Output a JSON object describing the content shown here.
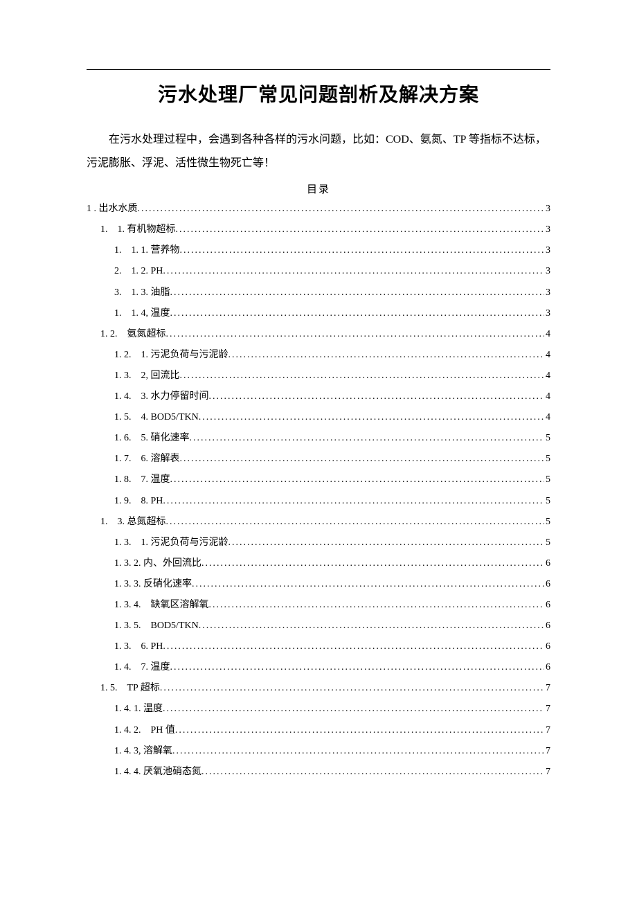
{
  "title": "污水处理厂常见问题剖析及解决方案",
  "intro": "在污水处理过程中，会遇到各种各样的污水问题，比如：COD、氨氮、TP 等指标不达标，污泥膨胀、浮泥、活性微生物死亡等！",
  "toc_header": "目录",
  "toc": [
    {
      "indent": 0,
      "label": "1 . 出水水质",
      "page": "3"
    },
    {
      "indent": 1,
      "label": "1.　1. 有机物超标",
      "page": "3"
    },
    {
      "indent": 2,
      "label": "1.　1. 1. 营养物",
      "page": "3"
    },
    {
      "indent": 2,
      "label": "2.　1. 2. PH",
      "page": "3"
    },
    {
      "indent": 2,
      "label": "3.　1. 3. 油脂",
      "page": "3"
    },
    {
      "indent": 2,
      "label": "1.　1. 4, 温度",
      "page": "3"
    },
    {
      "indent": 1,
      "label": "1. 2.　氨氮超标",
      "page": "4"
    },
    {
      "indent": 2,
      "label": "1. 2.　1. 污泥负荷与污泥龄",
      "page": "4"
    },
    {
      "indent": 2,
      "label": "1. 3.　2, 回流比",
      "page": "4"
    },
    {
      "indent": 2,
      "label": "1. 4.　3. 水力停留时间",
      "page": "4"
    },
    {
      "indent": 2,
      "label": "1. 5.　4. BOD5/TKN",
      "page": "4"
    },
    {
      "indent": 2,
      "label": "1. 6.　5. 硝化速率",
      "page": "5"
    },
    {
      "indent": 2,
      "label": "1. 7.　6. 溶解表",
      "page": "5"
    },
    {
      "indent": 2,
      "label": "1. 8.　7. 温度",
      "page": "5"
    },
    {
      "indent": 2,
      "label": "1. 9.　8. PH",
      "page": "5"
    },
    {
      "indent": 1,
      "label": "1.　3. 总氮超标",
      "page": "5"
    },
    {
      "indent": 2,
      "label": "1. 3.　1. 污泥负荷与污泥龄",
      "page": "5"
    },
    {
      "indent": 2,
      "label": "1. 3. 2. 内、外回流比",
      "page": "6"
    },
    {
      "indent": 2,
      "label": "1. 3. 3. 反硝化速率",
      "page": "6"
    },
    {
      "indent": 2,
      "label": "1. 3. 4.　缺氧区溶解氧",
      "page": "6"
    },
    {
      "indent": 2,
      "label": "1. 3. 5.　BOD5/TKN",
      "page": "6"
    },
    {
      "indent": 2,
      "label": "1. 3.　6. PH",
      "page": "6"
    },
    {
      "indent": 2,
      "label": "1. 4.　7. 温度",
      "page": "6"
    },
    {
      "indent": 1,
      "label": "1. 5.　TP 超标",
      "page": "7"
    },
    {
      "indent": 2,
      "label": "1. 4. 1. 温度",
      "page": "7"
    },
    {
      "indent": 2,
      "label": "1. 4. 2.　PH 值",
      "page": "7"
    },
    {
      "indent": 2,
      "label": "1. 4. 3, 溶解氧",
      "page": "7"
    },
    {
      "indent": 2,
      "label": "1. 4. 4. 厌氧池硝态氮",
      "page": "7"
    }
  ]
}
